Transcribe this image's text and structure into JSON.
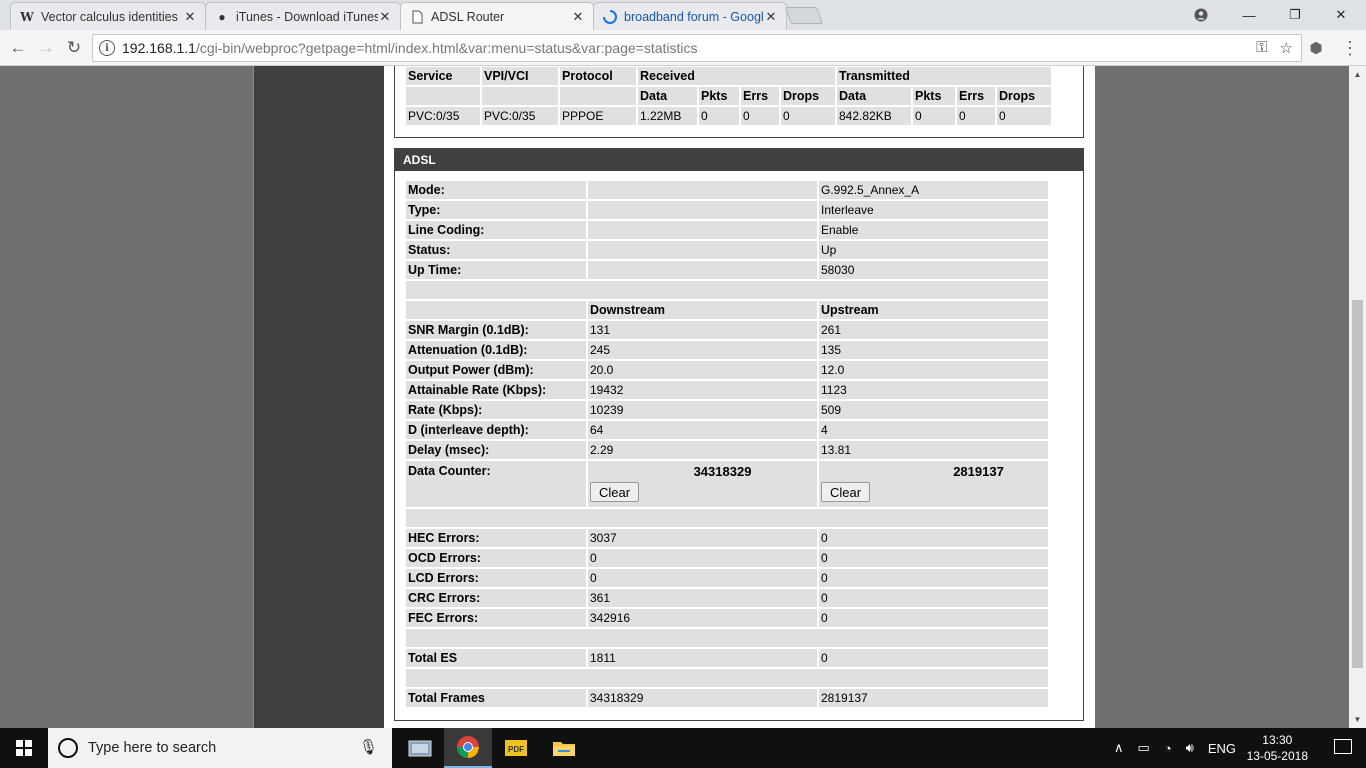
{
  "browser": {
    "tabs": [
      {
        "title": "Vector calculus identities",
        "favicon": "W"
      },
      {
        "title": "iTunes - Download iTunes",
        "favicon": "apple-icon"
      },
      {
        "title": "ADSL Router",
        "favicon": "page-icon",
        "active": true
      },
      {
        "title": "broadband forum - Google",
        "favicon": "loading-icon"
      }
    ],
    "url_host": "192.168.1.1",
    "url_path": "/cgi-bin/webproc?getpage=html/index.html&var:menu=status&var:page=statistics"
  },
  "wan": {
    "headers": {
      "service": "Service",
      "vpi_vci": "VPI/VCI",
      "protocol": "Protocol",
      "received": "Received",
      "transmitted": "Transmitted"
    },
    "sub_headers": [
      "Data",
      "Pkts",
      "Errs",
      "Drops",
      "Data",
      "Pkts",
      "Errs",
      "Drops"
    ],
    "row": [
      "PVC:0/35",
      "PVC:0/35",
      "PPPOE",
      "1.22MB",
      "0",
      "0",
      "0",
      "842.82KB",
      "0",
      "0",
      "0"
    ]
  },
  "adsl": {
    "title": "ADSL",
    "info": [
      {
        "label": "Mode:",
        "value": "G.992.5_Annex_A"
      },
      {
        "label": "Type:",
        "value": "Interleave"
      },
      {
        "label": "Line Coding:",
        "value": "Enable"
      },
      {
        "label": "Status:",
        "value": "Up"
      },
      {
        "label": "Up Time:",
        "value": "58030"
      }
    ],
    "downstream": "Downstream",
    "upstream": "Upstream",
    "stats": [
      {
        "label": "SNR Margin (0.1dB):",
        "down": "131",
        "up": "261"
      },
      {
        "label": "Attenuation (0.1dB):",
        "down": "245",
        "up": "135"
      },
      {
        "label": "Output Power (dBm):",
        "down": "20.0",
        "up": "12.0"
      },
      {
        "label": "Attainable Rate (Kbps):",
        "down": "19432",
        "up": "1123"
      },
      {
        "label": "Rate (Kbps):",
        "down": "10239",
        "up": "509"
      },
      {
        "label": "D (interleave depth):",
        "down": "64",
        "up": "4"
      },
      {
        "label": "Delay (msec):",
        "down": "2.29",
        "up": "13.81"
      }
    ],
    "counter": {
      "label": "Data Counter:",
      "down": "34318329",
      "up": "2819137",
      "clear": "Clear"
    },
    "errors": [
      {
        "label": "HEC Errors:",
        "down": "3037",
        "up": "0"
      },
      {
        "label": "OCD Errors:",
        "down": "0",
        "up": "0"
      },
      {
        "label": "LCD Errors:",
        "down": "0",
        "up": "0"
      },
      {
        "label": "CRC Errors:",
        "down": "361",
        "up": "0"
      },
      {
        "label": "FEC Errors:",
        "down": "342916",
        "up": "0"
      }
    ],
    "total_es": {
      "label": "Total ES",
      "down": "1811",
      "up": "0"
    },
    "total_frames": {
      "label": "Total Frames",
      "down": "34318329",
      "up": "2819137"
    }
  },
  "taskbar": {
    "search_placeholder": "Type here to search",
    "language": "ENG",
    "time": "13:30",
    "date": "13-05-2018"
  }
}
